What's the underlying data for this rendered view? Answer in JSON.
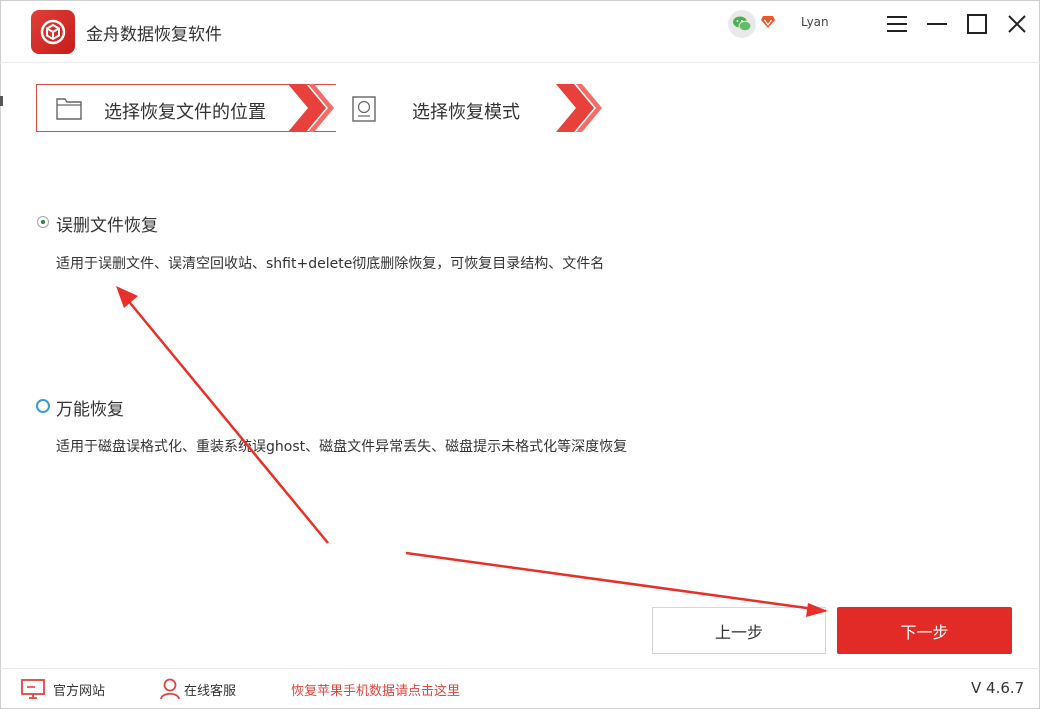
{
  "app": {
    "title": "金舟数据恢复软件",
    "username": "Lyan"
  },
  "steps": {
    "step1": "选择恢复文件的位置",
    "step2": "选择恢复模式"
  },
  "options": [
    {
      "title": "误删文件恢复",
      "desc": "适用于误删文件、误清空回收站、shfit+delete彻底删除恢复，可恢复目录结构、文件名",
      "selected": true
    },
    {
      "title": "万能恢复",
      "desc": "适用于磁盘误格式化、重装系统误ghost、磁盘文件异常丢失、磁盘提示未格式化等深度恢复",
      "selected": false
    }
  ],
  "buttons": {
    "prev": "上一步",
    "next": "下一步"
  },
  "footer": {
    "website": "官方网站",
    "service": "在线客服",
    "promo": "恢复苹果手机数据请点击这里",
    "version": "V 4.6.7"
  },
  "colors": {
    "accent": "#e22a26",
    "radio_blue": "#3a9ad6"
  },
  "icons": [
    "app-logo-icon",
    "wechat-icon",
    "vip-diamond-icon",
    "menu-icon",
    "minimize-icon",
    "maximize-icon",
    "close-icon",
    "folder-icon",
    "disk-icon",
    "monitor-icon",
    "user-icon"
  ]
}
